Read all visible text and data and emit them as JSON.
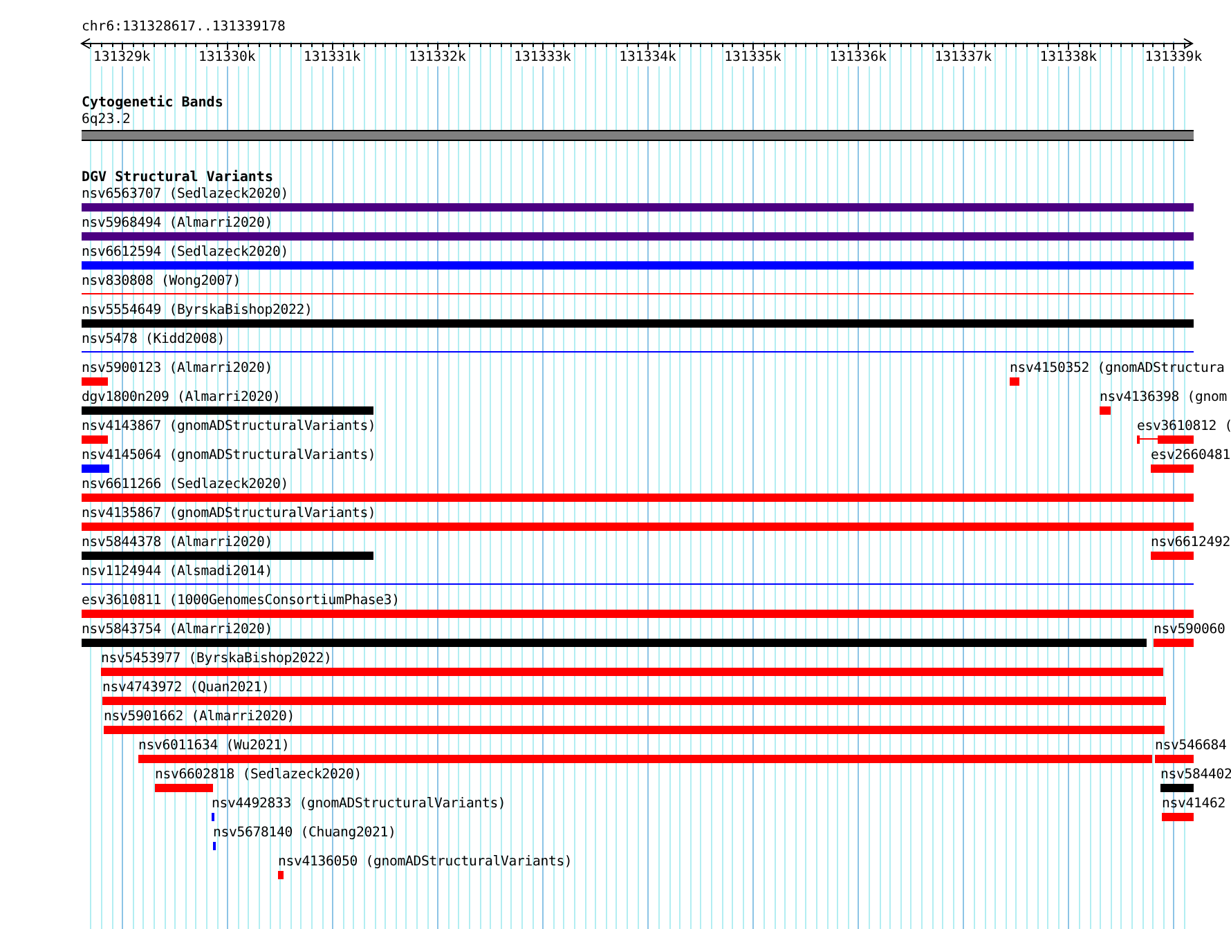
{
  "ruler": {
    "location": "chr6:131328617..131339178",
    "ticks": [
      "131329k",
      "131330k",
      "131331k",
      "131332k",
      "131333k",
      "131334k",
      "131335k",
      "131336k",
      "131337k",
      "131338k",
      "131339k"
    ]
  },
  "cytoband_track": {
    "title": "Cytogenetic Bands",
    "band": "6q23.2"
  },
  "variant_track": {
    "title": "DGV Structural Variants",
    "lanes": [
      {
        "features": [
          {
            "label": "nsv6563707 (Sedlazeck2020)",
            "kind": "block",
            "color": "#4b0082"
          }
        ]
      },
      {
        "features": [
          {
            "label": "nsv5968494 (Almarri2020)",
            "kind": "block",
            "color": "#4b0082"
          }
        ]
      },
      {
        "features": [
          {
            "label": "nsv6612594 (Sedlazeck2020)",
            "kind": "block",
            "color": "#0000ff"
          }
        ]
      },
      {
        "features": [
          {
            "label": "nsv830808 (Wong2007)",
            "kind": "line",
            "color": "#ff0000"
          }
        ]
      },
      {
        "features": [
          {
            "label": "nsv5554649 (ByrskaBishop2022)",
            "kind": "block",
            "color": "#000000"
          }
        ]
      },
      {
        "features": [
          {
            "label": "nsv5478 (Kidd2008)",
            "kind": "line",
            "color": "#0000ff"
          }
        ]
      },
      {
        "features": [
          {
            "label": "nsv5900123 (Almarri2020)",
            "kind": "block",
            "color": "#ff0000"
          },
          {
            "label": "nsv4150352 (gnomADStructura",
            "kind": "block",
            "color": "#ff0000"
          }
        ]
      },
      {
        "features": [
          {
            "label": "dgv1800n209 (Almarri2020)",
            "kind": "block",
            "color": "#000000"
          },
          {
            "label": "nsv4136398 (gnom",
            "kind": "block",
            "color": "#ff0000"
          }
        ]
      },
      {
        "features": [
          {
            "label": "nsv4143867 (gnomADStructuralVariants)",
            "kind": "block",
            "color": "#ff0000"
          },
          {
            "label": "esv3610812 (",
            "kind": "split",
            "color": "#ff0000"
          }
        ]
      },
      {
        "features": [
          {
            "label": "nsv4145064 (gnomADStructuralVariants)",
            "kind": "block",
            "color": "#0000ff"
          },
          {
            "label": "esv2660481",
            "kind": "block",
            "color": "#ff0000"
          }
        ]
      },
      {
        "features": [
          {
            "label": "nsv6611266 (Sedlazeck2020)",
            "kind": "block",
            "color": "#ff0000"
          }
        ]
      },
      {
        "features": [
          {
            "label": "nsv4135867 (gnomADStructuralVariants)",
            "kind": "block",
            "color": "#ff0000"
          }
        ]
      },
      {
        "features": [
          {
            "label": "nsv5844378 (Almarri2020)",
            "kind": "block",
            "color": "#000000"
          },
          {
            "label": "nsv6612492",
            "kind": "block",
            "color": "#ff0000"
          }
        ]
      },
      {
        "features": [
          {
            "label": "nsv1124944 (Alsmadi2014)",
            "kind": "line",
            "color": "#0000ff"
          }
        ]
      },
      {
        "features": [
          {
            "label": "esv3610811 (1000GenomesConsortiumPhase3)",
            "kind": "block",
            "color": "#ff0000"
          }
        ]
      },
      {
        "features": [
          {
            "label": "nsv5843754 (Almarri2020)",
            "kind": "block",
            "color": "#000000"
          },
          {
            "label": "nsv590060",
            "kind": "block",
            "color": "#ff0000"
          }
        ]
      },
      {
        "features": [
          {
            "label": "nsv5453977 (ByrskaBishop2022)",
            "kind": "block",
            "color": "#ff0000"
          }
        ]
      },
      {
        "features": [
          {
            "label": "nsv4743972 (Quan2021)",
            "kind": "block",
            "color": "#ff0000"
          }
        ]
      },
      {
        "features": [
          {
            "label": "nsv5901662 (Almarri2020)",
            "kind": "block",
            "color": "#ff0000"
          }
        ]
      },
      {
        "features": [
          {
            "label": "nsv6011634 (Wu2021)",
            "kind": "block",
            "color": "#ff0000"
          },
          {
            "label": "nsv546684",
            "kind": "block",
            "color": "#ff0000"
          }
        ]
      },
      {
        "features": [
          {
            "label": "nsv6602818 (Sedlazeck2020)",
            "kind": "block",
            "color": "#ff0000"
          },
          {
            "label": "nsv584402",
            "kind": "block",
            "color": "#000000"
          }
        ]
      },
      {
        "features": [
          {
            "label": "nsv4492833 (gnomADStructuralVariants)",
            "kind": "block",
            "color": "#0000ff"
          },
          {
            "label": "nsv41462",
            "kind": "block",
            "color": "#ff0000"
          }
        ]
      },
      {
        "features": [
          {
            "label": "nsv5678140 (Chuang2021)",
            "kind": "block",
            "color": "#0000ff"
          }
        ]
      },
      {
        "features": [
          {
            "label": "nsv4136050 (gnomADStructuralVariants)",
            "kind": "block",
            "color": "#ff0000"
          }
        ]
      }
    ]
  }
}
